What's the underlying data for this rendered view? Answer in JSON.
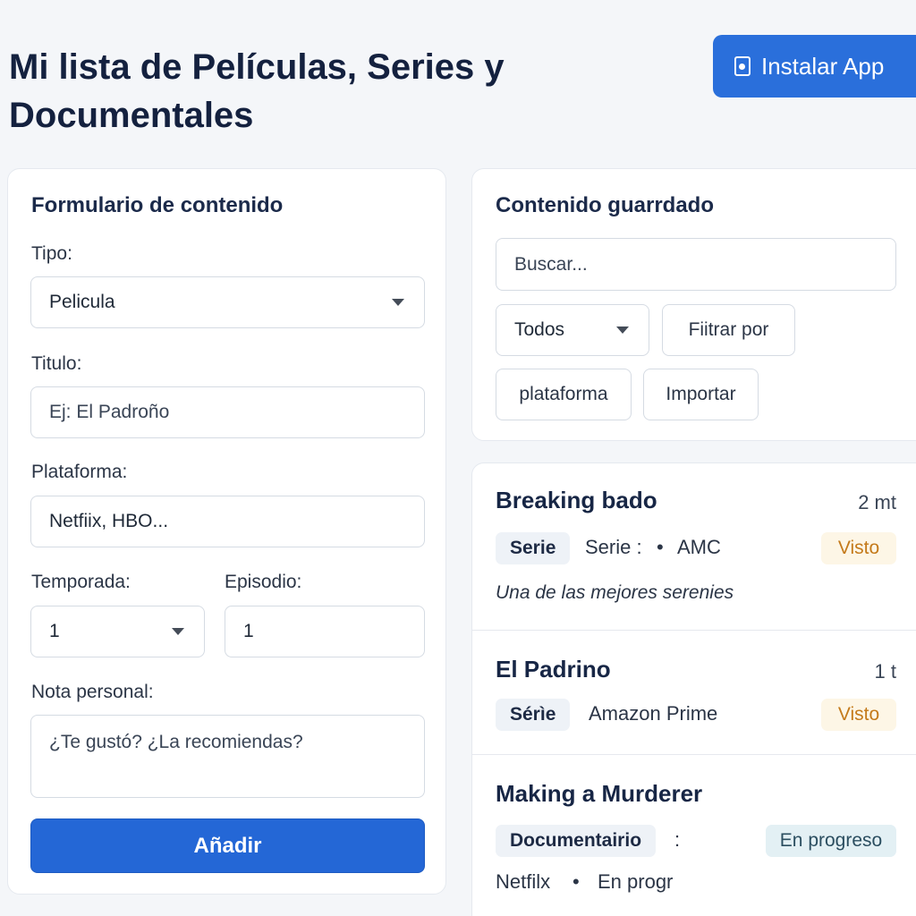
{
  "header": {
    "title": "Mi lista de Películas, Series y Documentales",
    "install_label": "Instalar App",
    "install_icon": "phone-install-icon"
  },
  "form": {
    "title": "Formulario de contenido",
    "type_label": "Tipo:",
    "type_value": "Pelicula",
    "title_label": "Titulo:",
    "title_placeholder": "Ej: El Padroño",
    "platform_label": "Plataforma:",
    "platform_placeholder": "Netfiix, HBO...",
    "season_label": "Temporada:",
    "season_value": "1",
    "episode_label": "Episodio:",
    "episode_value": "1",
    "note_label": "Nota personal:",
    "note_placeholder": "¿Te gustó? ¿La recomiendas?",
    "submit_label": "Añadir"
  },
  "saved": {
    "title": "Contenido guarrdado",
    "search_placeholder": "Buscar...",
    "filter_value": "Todos",
    "filter_platform_label": "Fiitrar por",
    "platform_label": "plataforma",
    "import_label": "Importar"
  },
  "items": [
    {
      "title": "Breaking bado",
      "time": "2 mt",
      "tag": "Serie",
      "meta_left": "Serie :",
      "bullet": "•",
      "meta_right": "AMC",
      "status": "Visto",
      "note": "Una de las mejores serenies"
    },
    {
      "title": "El Padrino",
      "time": "1 t",
      "tag": "Sérìe",
      "meta_right": "Amazon Prime",
      "status": "Visto"
    },
    {
      "title": "Making a Murderer",
      "tag": "Documentairio",
      "colon": ":",
      "status": "En progreso",
      "meta_left": "Netfilx",
      "bullet": "•",
      "meta_right": "En progr"
    }
  ],
  "colors": {
    "accent": "#2a6fdb",
    "seen": "#c47a1a",
    "progress": "#2b4e60"
  }
}
